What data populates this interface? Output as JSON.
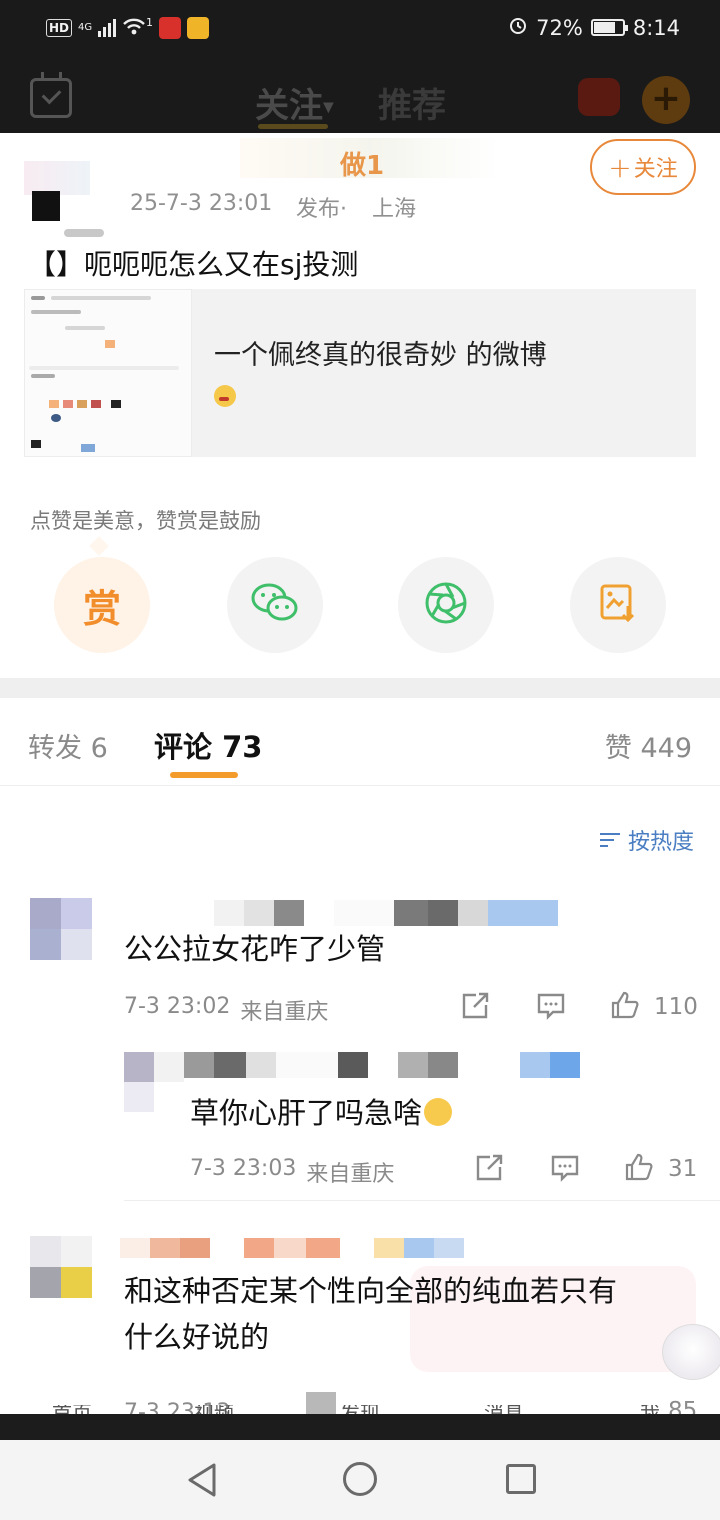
{
  "status_bar": {
    "left_badge": "HD",
    "network": "4G",
    "notification_count": "1",
    "battery": "72%",
    "time": "8:14"
  },
  "top_nav": {
    "tab_follow": "关注",
    "tab_recommend": "推荐",
    "plus": "+"
  },
  "post": {
    "author_partial": "做1 ",
    "time": "25-7-3 23:01",
    "source": "发布·",
    "location": "上海",
    "follow_button": "关注",
    "follow_plus": "+",
    "text": "【】呃呃呃怎么又在sj投测",
    "repost_card_text": "一个佩终真的很奇妙 的微博",
    "reward_hint": "点赞是美意，赞赏是鼓励",
    "reward_label": "赏"
  },
  "tabs": {
    "repost": "转发 6",
    "comment": "评论 73",
    "like": "赞 449"
  },
  "sort_label": "按热度",
  "comments": [
    {
      "text": "公公拉女花咋了少管",
      "time": "7-3 23:02",
      "location": "来自重庆",
      "likes": "110"
    },
    {
      "text": "草你心肝了吗急啥",
      "time": "7-3 23:03",
      "location": "来自重庆",
      "likes": "31"
    },
    {
      "text_line1": "和这种否定某个性向全部的纯血若只有",
      "text_line2": "什么好说的",
      "time": "7-3 23:13",
      "likes": "85"
    }
  ],
  "hidden_tabbar": [
    "首页",
    "视频",
    "发现",
    "消息",
    "我"
  ],
  "colors": {
    "accent_orange": "#f39c2c",
    "sort_blue": "#4a7dc2",
    "dark_bar": "#1a1a1a"
  }
}
